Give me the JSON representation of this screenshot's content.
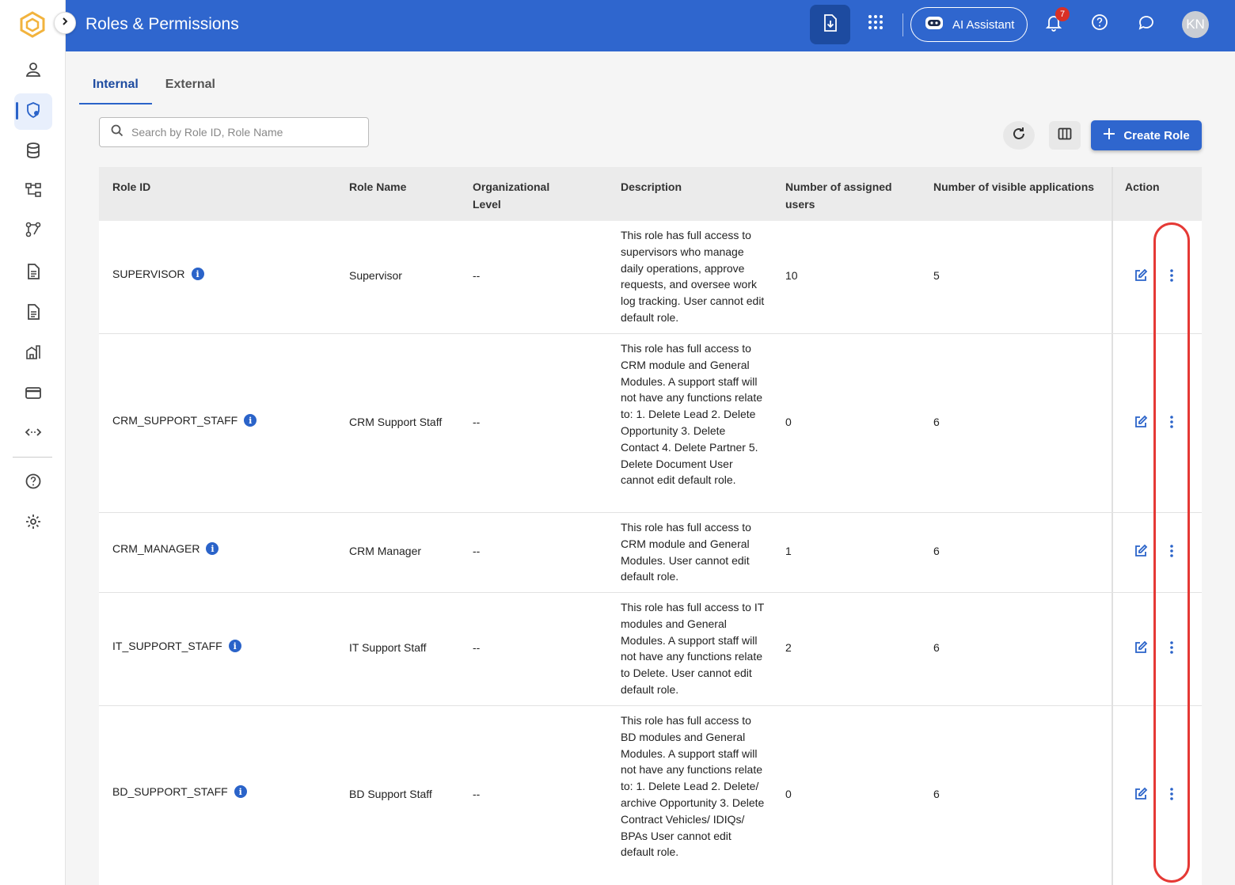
{
  "header": {
    "title": "Roles & Permissions",
    "ai_assistant_label": "AI Assistant",
    "notification_count": "7",
    "avatar_initials": "KN"
  },
  "tabs": [
    {
      "label": "Internal",
      "active": true
    },
    {
      "label": "External",
      "active": false
    }
  ],
  "search": {
    "placeholder": "Search by Role ID, Role Name"
  },
  "toolbar": {
    "create_label": "Create Role"
  },
  "table": {
    "columns": [
      "Role ID",
      "Role Name",
      "Organizational Level",
      "Description",
      "Number of assigned users",
      "Number of visible applications",
      "Action"
    ],
    "rows": [
      {
        "role_id": "SUPERVISOR",
        "role_name": "Supervisor",
        "org_level": "--",
        "description": "This role has full access to supervisors who manage daily operations, approve requests, and oversee work log tracking. User cannot edit default role.",
        "assigned_users": "10",
        "visible_apps": "5"
      },
      {
        "role_id": "CRM_SUPPORT_STAFF",
        "role_name": "CRM Support Staff",
        "org_level": "--",
        "description": "This role has full access to CRM module and General Modules. A support staff will not have any functions relate to: 1. Delete Lead 2. Delete Opportunity 3. Delete Contact 4. Delete Partner 5. Delete Document User cannot edit default role.",
        "assigned_users": "0",
        "visible_apps": "6"
      },
      {
        "role_id": "CRM_MANAGER",
        "role_name": "CRM Manager",
        "org_level": "--",
        "description": "This role has full access to CRM module and General Modules. User cannot edit default role.",
        "assigned_users": "1",
        "visible_apps": "6"
      },
      {
        "role_id": "IT_SUPPORT_STAFF",
        "role_name": "IT Support Staff",
        "org_level": "--",
        "description": "This role has full access to IT modules and General Modules. A support staff will not have any functions relate to Delete. User cannot edit default role.",
        "assigned_users": "2",
        "visible_apps": "6"
      },
      {
        "role_id": "BD_SUPPORT_STAFF",
        "role_name": "BD Support Staff",
        "org_level": "--",
        "description": "This role has full access to BD modules and General Modules. A support staff will not have any functions relate to: 1. Delete Lead 2. Delete/ archive Opportunity 3. Delete Contract Vehicles/ IDIQs/ BPAs User cannot edit default role.",
        "assigned_users": "0",
        "visible_apps": "6"
      }
    ]
  },
  "colors": {
    "brand": "#2f66ce",
    "highlight": "#e53935"
  }
}
